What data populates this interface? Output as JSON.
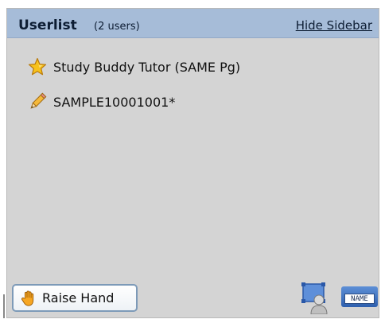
{
  "header": {
    "title": "Userlist",
    "count": "(2 users)",
    "hide_sidebar": "Hide Sidebar"
  },
  "users": [
    {
      "name": "Study Buddy Tutor (SAME Pg)",
      "icon": "star-icon"
    },
    {
      "name": "SAMPLE10001001*",
      "icon": "pencil-icon"
    }
  ],
  "footer": {
    "raise_hand_label": "Raise Hand",
    "video_icon": "webcam-user-icon",
    "name_icon": "name-tag-icon",
    "name_tag_text": "NAME"
  },
  "colors": {
    "header_bg": "#a6bcd8",
    "panel_bg": "#d4d4d4",
    "button_border": "#7d9ab8"
  }
}
